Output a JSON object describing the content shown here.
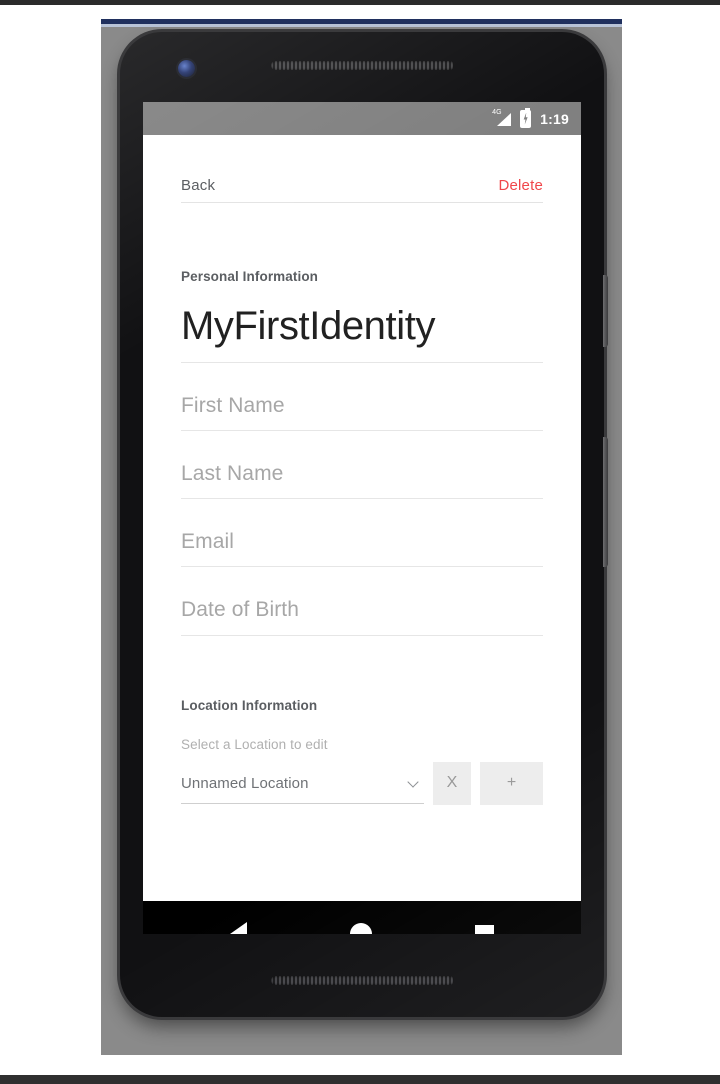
{
  "device": {
    "camera_icon": "front-camera-icon",
    "earpiece_icon": "earpiece-speaker-icon",
    "bottom_speaker_icon": "bottom-speaker-icon",
    "power_button": "power-button",
    "volume_button": "volume-rocker"
  },
  "status_bar": {
    "signal_icon": "signal-4g-icon",
    "signal_label": "4G",
    "battery_icon": "battery-charging-icon",
    "clock": "1:19",
    "background_color": "#808080",
    "text_color": "#ffffff"
  },
  "top_nav": {
    "back_label": "Back",
    "delete_label": "Delete",
    "delete_color": "#f0464a"
  },
  "personal_section": {
    "header": "Personal Information",
    "identity_title": "MyFirstIdentity",
    "fields": [
      {
        "name": "first-name",
        "placeholder": "First Name",
        "value": ""
      },
      {
        "name": "last-name",
        "placeholder": "Last Name",
        "value": ""
      },
      {
        "name": "email",
        "placeholder": "Email",
        "value": ""
      },
      {
        "name": "date-of-birth",
        "placeholder": "Date of Birth",
        "value": ""
      }
    ]
  },
  "location_section": {
    "header": "Location Information",
    "help_text": "Select a Location to edit",
    "select": {
      "value": "Unnamed Location",
      "chevron_icon": "chevron-down-icon"
    },
    "remove_button_label": "X",
    "add_button_label": "+",
    "button_background": "#ededed"
  },
  "nav_bar": {
    "back_icon": "triangle-back-icon",
    "home_icon": "circle-home-icon",
    "recents_icon": "square-recents-icon",
    "background_color": "#000000"
  }
}
